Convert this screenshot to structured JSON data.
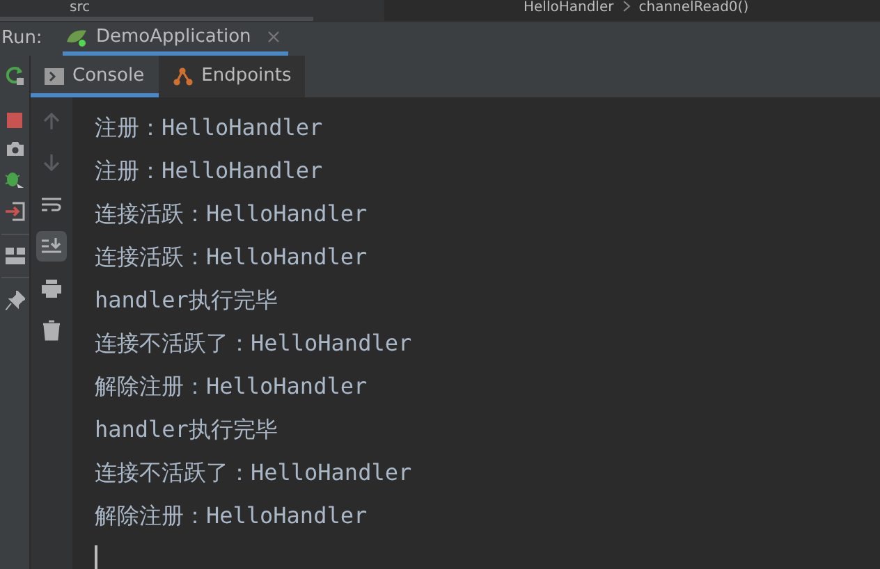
{
  "project_tree": {
    "item": "src"
  },
  "breadcrumbs": [
    "HelloHandler",
    "channelRead0()"
  ],
  "run_bar": {
    "label": "Run:",
    "tab": "DemoApplication"
  },
  "tool_tabs": [
    {
      "label": "Console",
      "kind": "console",
      "selected": true
    },
    {
      "label": "Endpoints",
      "kind": "endpoints",
      "selected": false
    }
  ],
  "console_toolbar": [
    {
      "kind": "up",
      "disabled": true,
      "selected": false
    },
    {
      "kind": "down",
      "disabled": true,
      "selected": false
    },
    {
      "kind": "wrap",
      "disabled": false,
      "selected": false
    },
    {
      "kind": "scroll_end",
      "disabled": false,
      "selected": true
    },
    {
      "kind": "print",
      "disabled": false,
      "selected": false
    },
    {
      "kind": "clear",
      "disabled": false,
      "selected": false
    }
  ],
  "console_lines": [
    "注册：HelloHandler",
    "注册：HelloHandler",
    "连接活跃：HelloHandler",
    "连接活跃：HelloHandler",
    "handler执行完毕",
    "连接不活跃了：HelloHandler",
    "解除注册：HelloHandler",
    "handler执行完毕",
    "连接不活跃了：HelloHandler",
    "解除注册：HelloHandler"
  ]
}
